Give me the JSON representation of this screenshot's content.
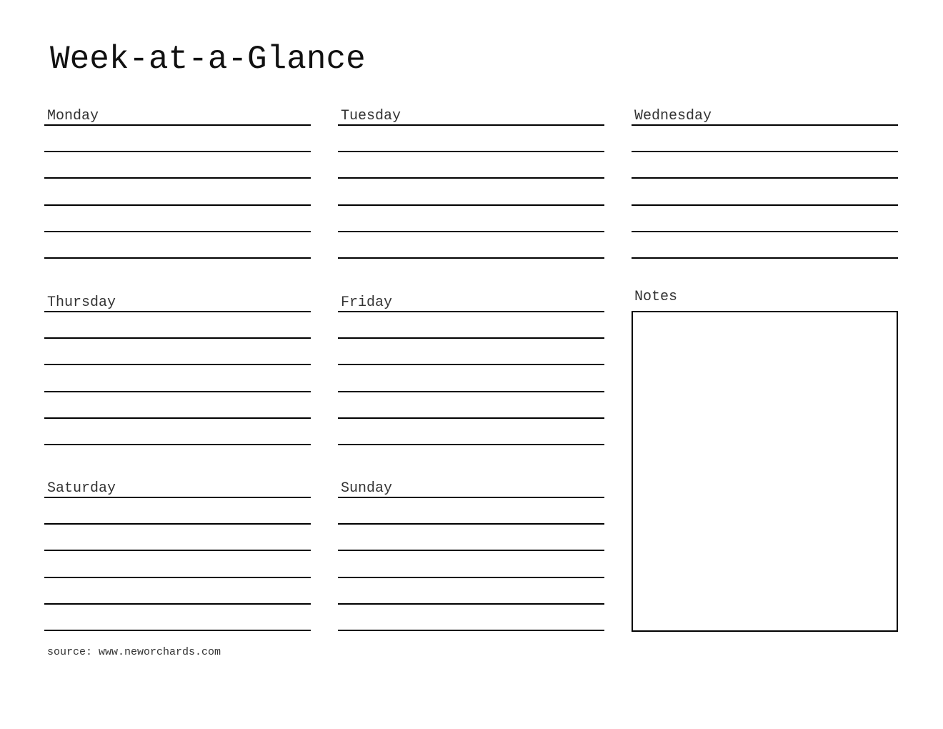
{
  "title": "Week-at-a-Glance",
  "days": [
    {
      "label": "Monday"
    },
    {
      "label": "Tuesday"
    },
    {
      "label": "Wednesday"
    },
    {
      "label": "Thursday"
    },
    {
      "label": "Friday"
    },
    {
      "label": "Saturday"
    },
    {
      "label": "Sunday"
    }
  ],
  "notes": {
    "label": "Notes"
  },
  "source": "source: www.neworchards.com"
}
